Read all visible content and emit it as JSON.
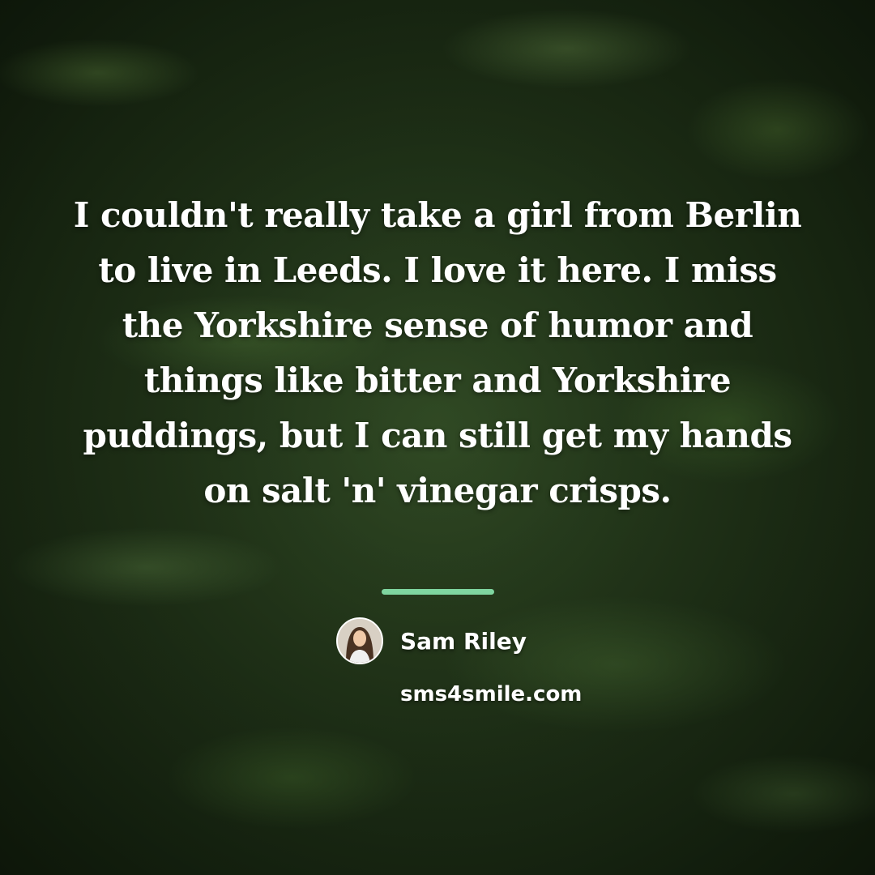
{
  "quote": {
    "text": "I couldn't really take a girl from Berlin to live in Leeds. I love it here. I miss the Yorkshire sense of humor and things like bitter and Yorkshire puddings, but I can still get my hands on salt 'n' vinegar crisps."
  },
  "author": {
    "name": "Sam Riley",
    "avatar_icon": "person-portrait-icon"
  },
  "site": {
    "url": "sms4smile.com"
  },
  "colors": {
    "divider": "#7fd6a0",
    "text": "#ffffff",
    "background": "#2b4420"
  }
}
